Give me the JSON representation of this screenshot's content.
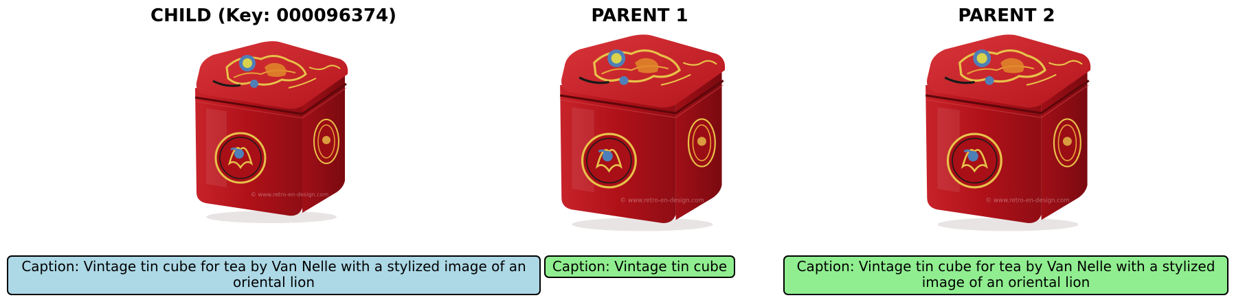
{
  "panels": {
    "child": {
      "title": "CHILD (Key: 000096374)",
      "caption": "Caption: Vintage tin cube for tea by Van Nelle with a stylized image of an oriental lion",
      "caption_color": "#add8e6"
    },
    "parent1": {
      "title": "PARENT 1",
      "caption": "Caption: Vintage tin cube",
      "caption_color": "#90ee90"
    },
    "parent2": {
      "title": "PARENT 2",
      "caption": "Caption: Vintage tin cube for tea by Van Nelle with a stylized image of an oriental lion",
      "caption_color": "#90ee90"
    }
  },
  "image": {
    "subject": "red-tea-tin-cube-photo",
    "tin_color": "#b3121b",
    "ornament_color": "#e8c14a",
    "accent_color": "#4f7fb8"
  }
}
